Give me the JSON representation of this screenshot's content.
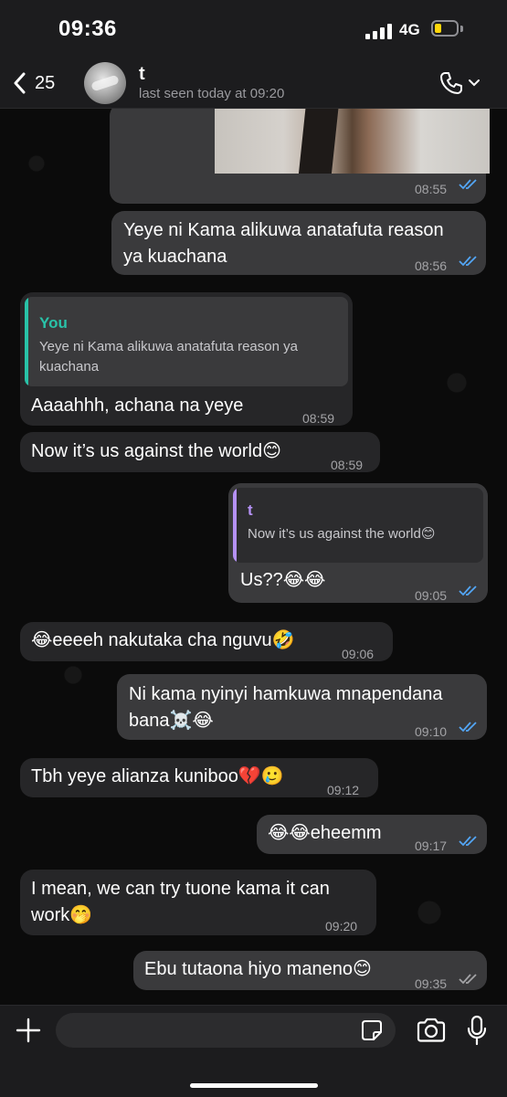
{
  "status_bar": {
    "time": "09:36",
    "network": "4G"
  },
  "header": {
    "back_count": "25",
    "contact_name": "t",
    "last_seen": "last seen today at 09:20",
    "icons": {
      "back": "chevron-left-icon",
      "call": "phone-icon",
      "call_menu": "chevron-down-icon"
    }
  },
  "messages": [
    {
      "direction": "out",
      "type": "image",
      "time": "08:55",
      "status": "read"
    },
    {
      "direction": "out",
      "text_lines": [
        "Yeye ni Kama alikuwa anatafuta reason",
        "ya kuachana"
      ],
      "time": "08:56",
      "status": "read"
    },
    {
      "direction": "in",
      "quote": {
        "author": "You",
        "text_lines": [
          "Yeye ni Kama alikuwa anatafuta reason ya",
          "kuachana"
        ]
      },
      "text_lines": [
        "Aaaahhh, achana na yeye"
      ],
      "time": "08:59"
    },
    {
      "direction": "in",
      "text_lines": [
        "Now it’s us against the world😊"
      ],
      "time": "08:59"
    },
    {
      "direction": "out",
      "quote": {
        "author": "t",
        "text_lines": [
          "Now it’s us against the world😊"
        ]
      },
      "text_lines": [
        "Us??😂😂"
      ],
      "time": "09:05",
      "status": "read"
    },
    {
      "direction": "in",
      "text_lines": [
        "😂eeeeh nakutaka cha nguvu🤣"
      ],
      "time": "09:06"
    },
    {
      "direction": "out",
      "text_lines": [
        "Ni kama nyinyi hamkuwa mnapendana",
        "bana☠️😂"
      ],
      "time": "09:10",
      "status": "read"
    },
    {
      "direction": "in",
      "text_lines": [
        "Tbh yeye alianza kuniboo💔🥲"
      ],
      "time": "09:12"
    },
    {
      "direction": "out",
      "text_lines": [
        "😂😂eheemm"
      ],
      "time": "09:17",
      "status": "read"
    },
    {
      "direction": "in",
      "text_lines": [
        "I mean, we can try tuone kama it can",
        "work🤭"
      ],
      "time": "09:20"
    },
    {
      "direction": "out",
      "text_lines": [
        "Ebu tutaona hiyo maneno😊"
      ],
      "time": "09:35",
      "status": "delivered"
    }
  ],
  "input_bar": {
    "placeholder": "",
    "icons": {
      "attach": "plus-icon",
      "sticker": "sticker-icon",
      "camera": "camera-icon",
      "mic": "microphone-icon"
    }
  },
  "colors": {
    "background": "#0b0b0b",
    "bar": "#1c1c1e",
    "outgoing_bubble": "#3a3a3c",
    "incoming_bubble": "#262628",
    "read_ticks": "#53a6f5",
    "delivered_ticks": "#a3a3a6",
    "quote_you": "#29c2a8",
    "quote_contact": "#b591f5",
    "battery": "#ffd60a"
  }
}
